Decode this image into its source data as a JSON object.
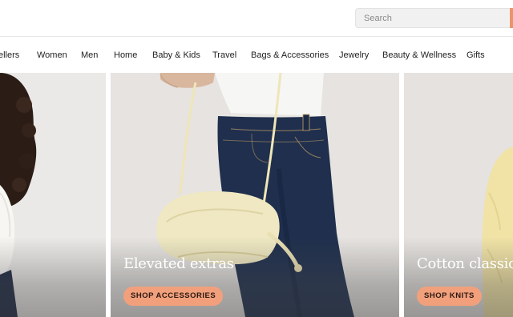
{
  "header": {
    "search": {
      "placeholder": "Search",
      "value": ""
    }
  },
  "nav": {
    "items": [
      {
        "label": "ellers",
        "id": "best-sellers"
      },
      {
        "label": "Women",
        "id": "women"
      },
      {
        "label": "Men",
        "id": "men"
      },
      {
        "label": "Home",
        "id": "home"
      },
      {
        "label": "Baby & Kids",
        "id": "baby-kids"
      },
      {
        "label": "Travel",
        "id": "travel"
      },
      {
        "label": "Bags & Accessories",
        "id": "bags-accessories"
      },
      {
        "label": "Jewelry",
        "id": "jewelry"
      },
      {
        "label": "Beauty & Wellness",
        "id": "beauty-wellness"
      },
      {
        "label": "Gifts",
        "id": "gifts"
      }
    ]
  },
  "tiles": [
    {
      "title": "",
      "cta": ""
    },
    {
      "title": "Elevated extras",
      "cta": "SHOP ACCESSORIES"
    },
    {
      "title": "Cotton classics",
      "cta": "SHOP KNITS"
    }
  ],
  "colors": {
    "accent": "#f2a07c",
    "denim": "#1f2f4d",
    "bag": "#efe8c2"
  }
}
